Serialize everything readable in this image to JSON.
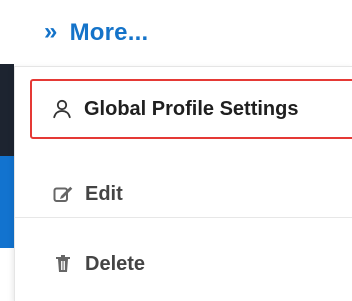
{
  "header": {
    "more_label": "More...",
    "more_icon": "double-chevron-right-icon",
    "accent_color": "#1473c9"
  },
  "menu": {
    "items": [
      {
        "label": "Global Profile Settings",
        "icon": "user-icon",
        "selected": true
      },
      {
        "label": "Edit",
        "icon": "edit-icon",
        "selected": false
      },
      {
        "label": "Delete",
        "icon": "trash-icon",
        "selected": false
      }
    ],
    "highlight_color": "#e53935"
  }
}
